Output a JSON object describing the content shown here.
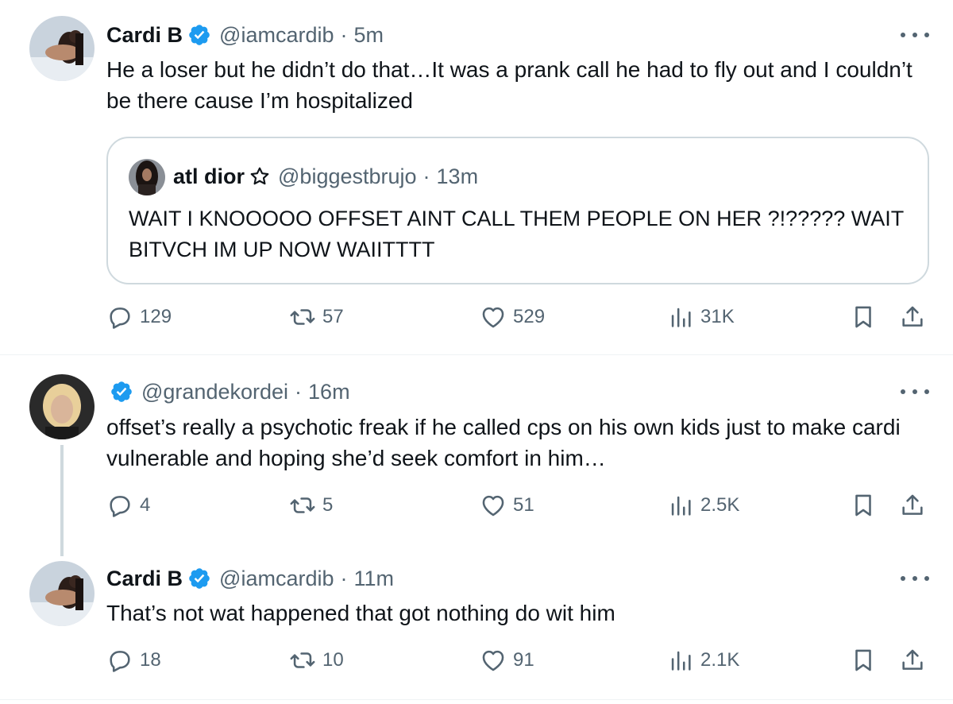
{
  "tweets": [
    {
      "name": "Cardi B",
      "handle": "@iamcardib",
      "time": "5m",
      "text": "He a loser but he didn’t do that…It was a prank call he had to fly out and I couldn’t be there cause I’m hospitalized",
      "replies": "129",
      "retweets": "57",
      "likes": "529",
      "views": "31K",
      "quote": {
        "name": "atl dior",
        "handle": "@biggestbrujo",
        "time": "13m",
        "text": "WAIT I KNOOOOO OFFSET AINT CALL THEM PEOPLE ON HER ?!????? WAIT BITVCH IM UP NOW WAIITTTT"
      }
    },
    {
      "name": "",
      "handle": "@grandekordei",
      "time": "16m",
      "text": "offset’s really a psychotic freak if he called cps on his own kids just to make cardi vulnerable and hoping she’d seek comfort in him…",
      "replies": "4",
      "retweets": "5",
      "likes": "51",
      "views": "2.5K"
    },
    {
      "name": "Cardi B",
      "handle": "@iamcardib",
      "time": "11m",
      "text": "That’s not wat happened that got nothing do wit him",
      "replies": "18",
      "retweets": "10",
      "likes": "91",
      "views": "2.1K"
    }
  ],
  "separator": "·",
  "icons": {
    "verified": "verified-badge-icon",
    "star": "star-outline-icon",
    "more": "more-horizontal-icon",
    "reply": "reply-bubble-icon",
    "retweet": "retweet-icon",
    "like": "heart-icon",
    "views": "views-bar-chart-icon",
    "bookmark": "bookmark-icon",
    "share": "share-upload-icon"
  },
  "colors": {
    "text": "#0f1419",
    "secondary": "#536471",
    "verified": "#1d9bf0",
    "border": "#cfd9de",
    "divider": "#eff3f4"
  }
}
